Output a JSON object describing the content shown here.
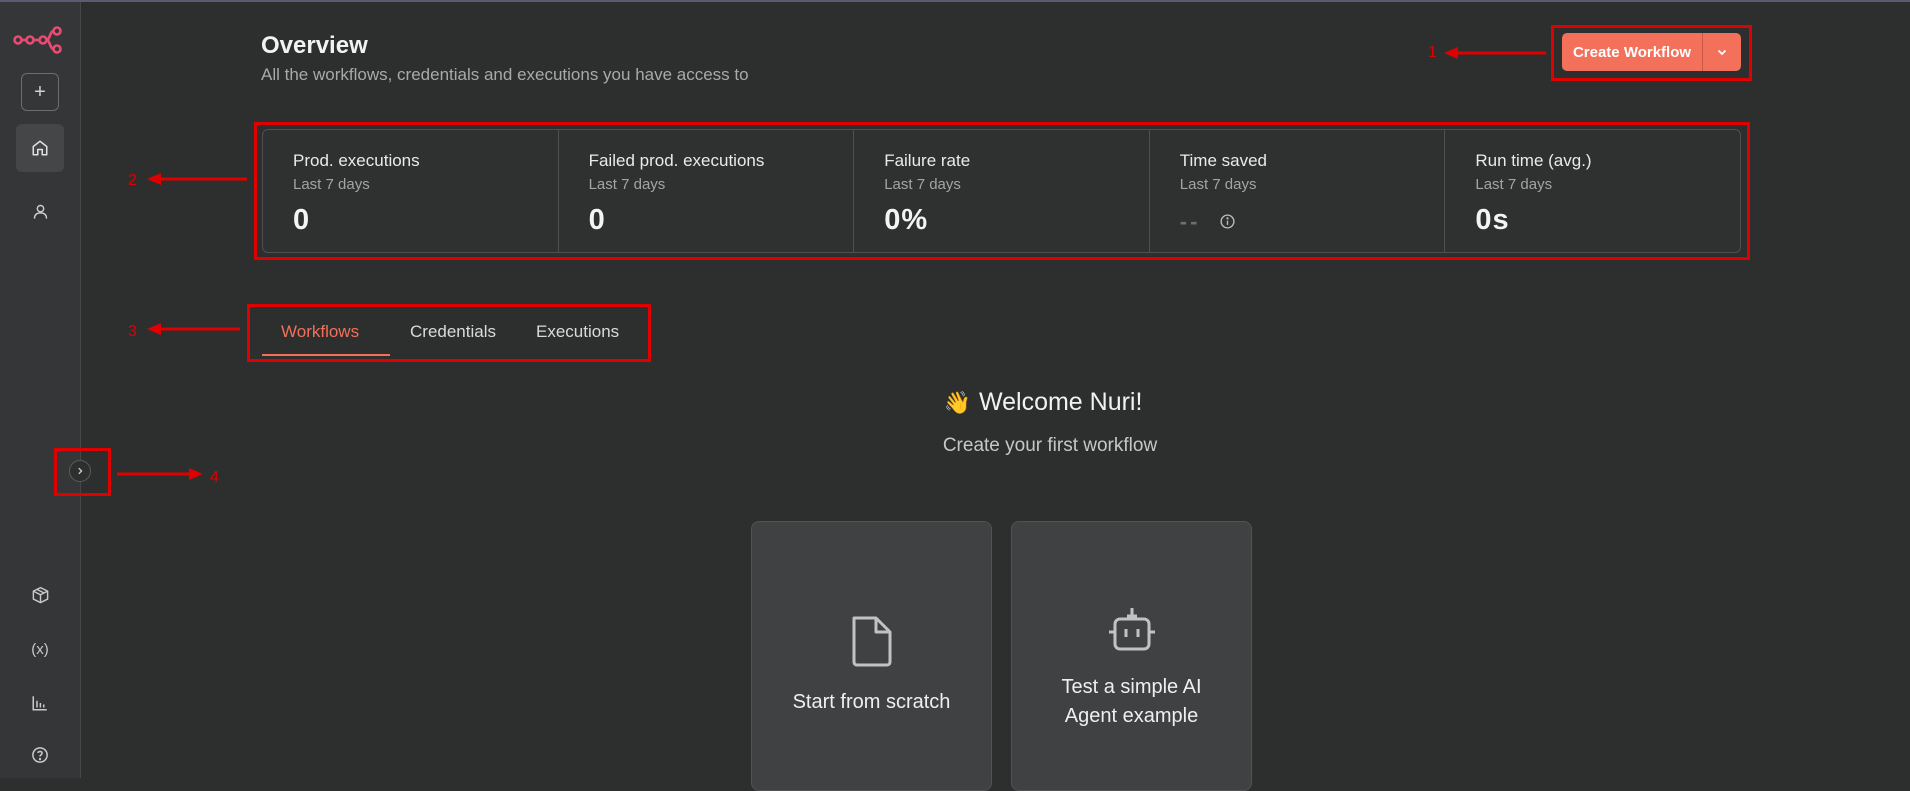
{
  "header": {
    "title": "Overview",
    "subtitle": "All the workflows, credentials and executions you have access to",
    "create_label": "Create Workflow"
  },
  "stats": [
    {
      "label": "Prod. executions",
      "sub": "Last 7 days",
      "value": "0"
    },
    {
      "label": "Failed prod. executions",
      "sub": "Last 7 days",
      "value": "0"
    },
    {
      "label": "Failure rate",
      "sub": "Last 7 days",
      "value": "0%"
    },
    {
      "label": "Time saved",
      "sub": "Last 7 days",
      "value": "--"
    },
    {
      "label": "Run time (avg.)",
      "sub": "Last 7 days",
      "value": "0s"
    }
  ],
  "tabs": [
    {
      "label": "Workflows",
      "active": true
    },
    {
      "label": "Credentials",
      "active": false
    },
    {
      "label": "Executions",
      "active": false
    }
  ],
  "welcome": {
    "emoji": "👋",
    "title": "Welcome Nuri!",
    "subtitle": "Create your first workflow"
  },
  "cards": [
    {
      "label": "Start from scratch",
      "icon": "file-icon"
    },
    {
      "label": "Test a simple AI Agent example",
      "icon": "robot-icon"
    }
  ],
  "annotations": [
    "1",
    "2",
    "3",
    "4"
  ],
  "colors": {
    "accent": "#f3705a",
    "background": "#2d2e2e",
    "sidebar": "#353637",
    "annotation": "#e00000",
    "logo": "#ea4b71"
  }
}
